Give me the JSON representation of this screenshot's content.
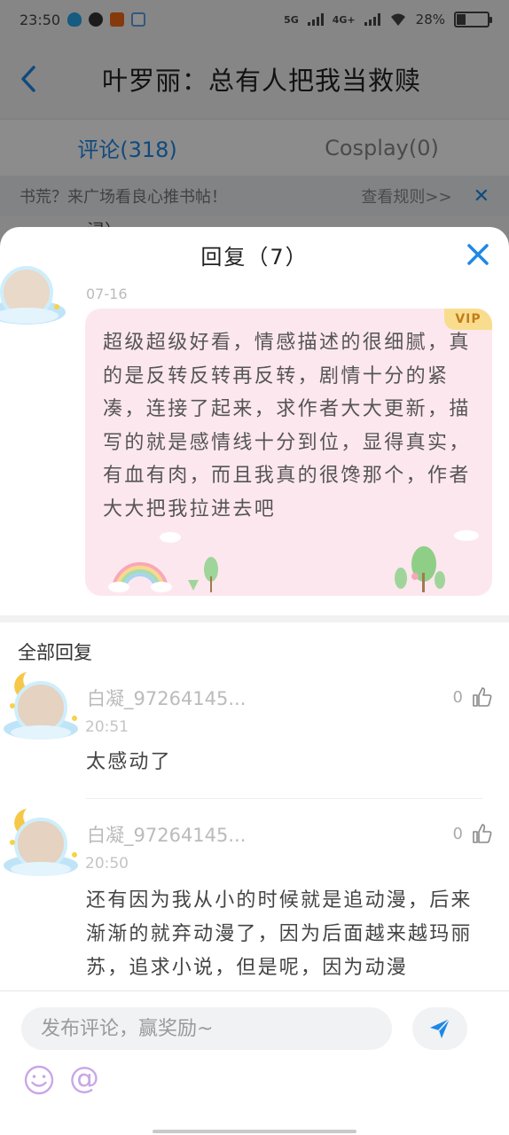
{
  "status_bar": {
    "time": "23:50",
    "network_5g": "5G",
    "network_4g": "4G+",
    "battery": "28%",
    "battery_level": 0.28
  },
  "header": {
    "title": "叶罗丽：总有人把我当救赎"
  },
  "tabs": [
    {
      "label": "评论(318)",
      "active": true
    },
    {
      "label": "Cosplay(0)",
      "active": false
    }
  ],
  "notice": {
    "text": "书荒？来广场看良心推书帖！",
    "link": "查看规则>>"
  },
  "peek_text": "浸）",
  "sheet": {
    "title": "回复（7）",
    "main_comment": {
      "date": "07-16",
      "badge": "VIP",
      "text": "超级超级好看，情感描述的很细腻，真的是反转反转再反转，剧情十分的紧凑，连接了起来，求作者大大更新，描写的就是感情线十分到位，显得真实，有血有肉，而且我真的很馋那个，作者大大把我拉进去吧"
    },
    "all_replies_label": "全部回复",
    "replies": [
      {
        "name": "白凝_97264145...",
        "time": "20:51",
        "likes": "0",
        "text": "太感动了"
      },
      {
        "name": "白凝_97264145...",
        "time": "20:50",
        "likes": "0",
        "text": "还有因为我从小的时候就是追动漫，后来渐渐的就弃动漫了，因为后面越来越玛丽苏，追求小说，但是呢，因为动漫"
      }
    ]
  },
  "input_bar": {
    "placeholder": "发布评论，赢奖励~"
  },
  "colors": {
    "accent": "#1e88e5",
    "vip_card": "#fde7ee",
    "vip_badge": "#f9dd8f"
  },
  "icons": [
    "back-icon",
    "close-icon",
    "like-icon",
    "send-icon",
    "emoji-icon",
    "at-icon"
  ]
}
